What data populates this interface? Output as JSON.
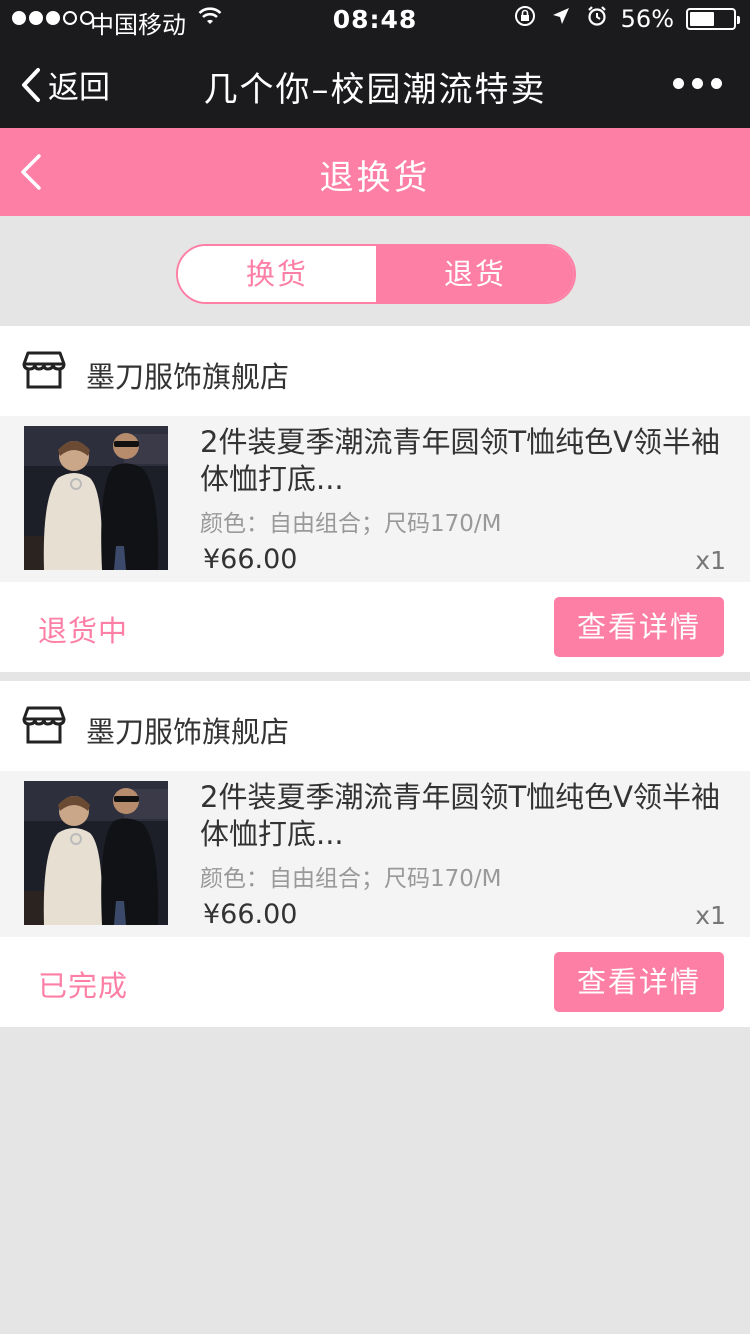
{
  "status_bar": {
    "carrier": "中国移动",
    "time": "08:48",
    "battery_percent": "56%",
    "battery_level": 0.56,
    "signal_bars": 3,
    "icons": [
      "wifi-icon",
      "orientation-lock-icon",
      "location-icon",
      "alarm-icon",
      "battery-icon"
    ]
  },
  "nav": {
    "back_label": "返回",
    "title": "几个你–校园潮流特卖"
  },
  "page": {
    "title": "退换货"
  },
  "tabs": {
    "exchange": "换货",
    "refund": "退货",
    "active": "refund"
  },
  "colors": {
    "accent": "#fe7fa6",
    "nav_bg": "#1b1b1e",
    "page_bg": "#e5e5e5"
  },
  "orders": [
    {
      "shop_name": "墨刀服饰旗舰店",
      "product_name": "2件装夏季潮流青年圆领T恤纯色V领半袖体恤打底...",
      "spec": "颜色：自由组合；尺码170/M",
      "price": "¥66.00",
      "quantity": "x1",
      "status": "退货中",
      "action": "查看详情"
    },
    {
      "shop_name": "墨刀服饰旗舰店",
      "product_name": "2件装夏季潮流青年圆领T恤纯色V领半袖体恤打底...",
      "spec": "颜色：自由组合；尺码170/M",
      "price": "¥66.00",
      "quantity": "x1",
      "status": "已完成",
      "action": "查看详情"
    }
  ]
}
